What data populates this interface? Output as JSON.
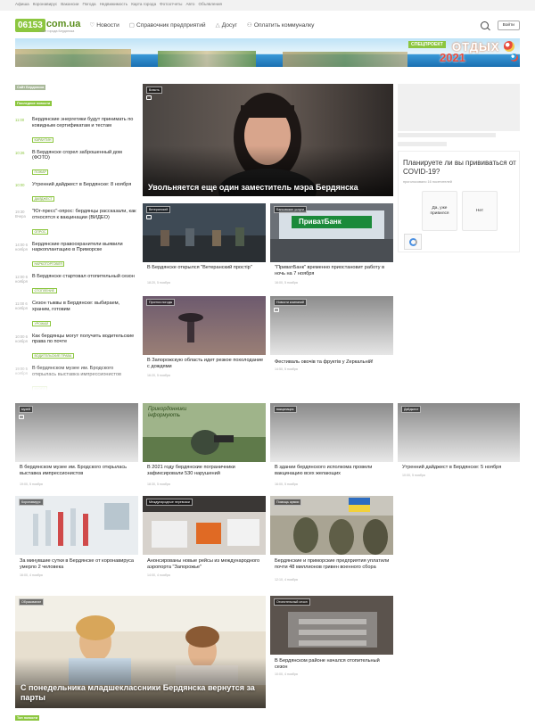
{
  "topline": [
    "Афиша",
    "Коронавирус",
    "Вакансии",
    "Погода",
    "Недвижимость",
    "Карта города",
    "Фотоотчеты",
    "Авто",
    "Объявления"
  ],
  "header": {
    "logo_number": "06153",
    "logo_domain": "com.ua",
    "logo_slogan": "Сайт города Бердянска",
    "nav": [
      {
        "icon": "heart-icon",
        "glyph": "♡",
        "label": "Новости"
      },
      {
        "icon": "book-icon",
        "glyph": "▢",
        "label": "Справочник предприятий"
      },
      {
        "icon": "tent-icon",
        "glyph": "△",
        "label": "Досуг"
      },
      {
        "icon": "coins-icon",
        "glyph": "⚇",
        "label": "Оплатить коммуналку"
      }
    ],
    "login_label": "Войти"
  },
  "banner": {
    "tag": "СПЕЦПРОЕКТ",
    "title": "ОТДЫХ",
    "year": "2021"
  },
  "feed": {
    "tag_top": "Сайт Бердянска",
    "tag_main": "Последние новости",
    "items": [
      {
        "time": "11:00",
        "title": "Бердянские энергетики будут принимать по ковидным сертификатам и тестам",
        "cat": "КАРАНТИН"
      },
      {
        "time": "10:26",
        "title": "В Бердянске сгорел заброшенный дом (ФОТО)",
        "cat": "ПОЖАР"
      },
      {
        "time": "10:00",
        "title": "Утренний дайджест в Бердянске: 8 ноября",
        "cat": "ДАЙДЖЕСТ"
      },
      {
        "time": "19:30 Вчера",
        "title": "\"Юг-пресс\"-опрос: бердянцы рассказали, как относятся к вакцинации (ВИДЕО)",
        "cat": "ОПРОС"
      },
      {
        "time": "14:00 6 ноября",
        "title": "Бердянские правоохранители выявили наркоплантацию в Приморске",
        "cat": "НАРКОТОРГОВЛЯ"
      },
      {
        "time": "12:00 6 ноября",
        "title": "В Бердянске стартовал отопительный сезон",
        "cat": "ОТОПЛЕНИЕ"
      },
      {
        "time": "11:00 6 ноября",
        "title": "Сезон тыквы в Бердянске: выбираем, храним, готовим",
        "cat": "УРОЖАЙ"
      },
      {
        "time": "10:00 6 ноября",
        "title": "Как бердянцы могут получить водительские права по почте",
        "cat": "ВОДИТЕЛЬСКИЕ ПРАВА"
      },
      {
        "time": "19:00 5 ноября",
        "title": "В бердянском музее им. Бродского открылась выставка импрессионистов",
        "cat": "МУЗЕЙ"
      },
      {
        "time": "18:30 5 ноября",
        "title": "В 2021 году бердянские пограничники зафиксировали 530 нарушений",
        "cat": "ПОГРАНСЛУЖБА"
      },
      {
        "time": "16:00 5 ноября",
        "title": "В здании бердянского исполкома провели вакцинацию всех желающих",
        "cat": ""
      }
    ]
  },
  "hero": {
    "tag": "Власть",
    "title": "Увольняется еще один заместитель мэра Бердянска"
  },
  "grid_row1": [
    {
      "tag": "Ветеранский",
      "title": "В Бердянске открылся \"Ветеранский простір\"",
      "date": "18:20, 5 ноября"
    },
    {
      "tag": "Банковские услуги",
      "title": "\"ПриватБанк\" временно приостановит работу в ночь на 7 ноября",
      "date": "16:00, 5 ноября"
    }
  ],
  "grid_row2": [
    {
      "tag": "Прогноз погоды",
      "title": "В Запорожскую область идет резкое похолодание с дождями",
      "date": "16:20, 5 ноября"
    },
    {
      "tag": "Новости компаний",
      "title": "Фестиваль овочів та фруктів у Zеркальній!",
      "date": "14:50, 5 ноября"
    }
  ],
  "privat_logo": "ПриватБанк",
  "border_caption": "Прикордонники інформують",
  "row3": [
    {
      "tag": "музей",
      "title": "В бердянском музее им. Бродского открылась выставка импрессионистов",
      "date": "19:00, 5 ноября"
    },
    {
      "tag": "",
      "title": "В 2021 году бердянские пограничники зафиксировали 530 нарушений",
      "date": "18:30, 5 ноября"
    },
    {
      "tag": "вакцинация",
      "title": "В здании бердянского исполкома провели вакцинацию всех желающих",
      "date": "16:00, 5 ноября"
    },
    {
      "tag": "Дайджест",
      "title": "Утренний дайджест в Бердянске: 5 ноября",
      "date": "10:00, 5 ноября"
    }
  ],
  "row4": [
    {
      "tag": "Коронавирус",
      "title": "За минувшие сутки в Бердянске от коронавируса умерло 2 человека",
      "date": "16:00, 4 ноября"
    },
    {
      "tag": "Международные перевозки",
      "title": "Анонсированы новые рейсы из международного аэропорта \"Запорожье\"",
      "date": "14:00, 4 ноября"
    },
    {
      "tag": "Помощь армии",
      "title": "Бердянские и приморские предприятия уплатили почти 48 миллионов гривен военного сбора",
      "date": "12:10, 4 ноября"
    }
  ],
  "row5": [
    {
      "tag": "Образование",
      "title": "С понедельника младшеклассники Бердянска вернутся за парты"
    },
    {
      "tag": "Отопительный сезон",
      "title": "В Бердянском районе начался отопительный сезон",
      "date": "10:00, 4 ноября"
    }
  ],
  "poll": {
    "question": "Планируете ли вы прививаться от COVID-19?",
    "note": "проголосовало 16 посетителей",
    "option_yes": "Да, уже привился",
    "option_no": "Нет"
  },
  "bottom_tag": "Топ новости"
}
